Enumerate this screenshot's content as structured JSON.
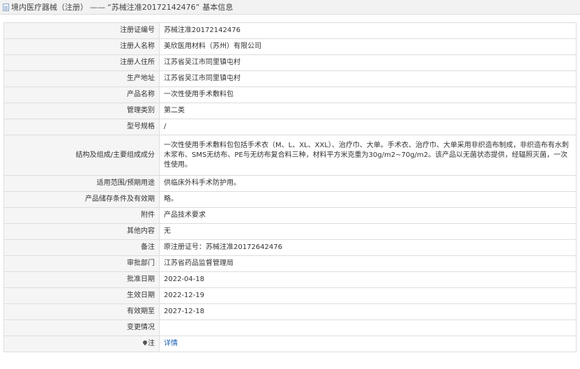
{
  "header": {
    "category": "境内医疗器械（注册）",
    "separator": "——",
    "reg_no_quoted": "“苏械注准20172142476”",
    "section": "基本信息"
  },
  "rows": [
    {
      "label": "注册证编号",
      "value": "苏械注准20172142476"
    },
    {
      "label": "注册人名称",
      "value": "美欣医用材料（苏州）有限公司"
    },
    {
      "label": "注册人住所",
      "value": "江苏省吴江市同里镇屯村"
    },
    {
      "label": "生产地址",
      "value": "江苏省吴江市同里镇屯村"
    },
    {
      "label": "产品名称",
      "value": "一次性使用手术敷料包"
    },
    {
      "label": "管理类别",
      "value": "第二类"
    },
    {
      "label": "型号规格",
      "value": "/"
    },
    {
      "label": "结构及组成/主要组成成分",
      "value": "一次性使用手术敷料包包括手术衣（M、L、XL、XXL）、治疗巾、大单。手术衣、治疗巾、大单采用非织造布制成，非织造布有水刺木浆布、SMS无纺布、PE与无纺布复合料三种，材料平方米克重为30g/m2~70g/m2。该产品以无菌状态提供，经辐照灭菌，一次性使用。"
    },
    {
      "label": "适用范围/预期用途",
      "value": "供临床外科手术防护用。"
    },
    {
      "label": "产品储存条件及有效期",
      "value": "略。"
    },
    {
      "label": "附件",
      "value": "产品技术要求"
    },
    {
      "label": "其他内容",
      "value": "无"
    },
    {
      "label": "备注",
      "value": "原注册证号：苏械注准20172642476"
    },
    {
      "label": "审批部门",
      "value": "江苏省药品监督管理局"
    },
    {
      "label": "批准日期",
      "value": "2022-04-18"
    },
    {
      "label": "生效日期",
      "value": "2022-12-19"
    },
    {
      "label": "有效期至",
      "value": "2027-12-18"
    },
    {
      "label": "变更情况",
      "value": ""
    },
    {
      "label": "注",
      "value": "详情"
    }
  ]
}
